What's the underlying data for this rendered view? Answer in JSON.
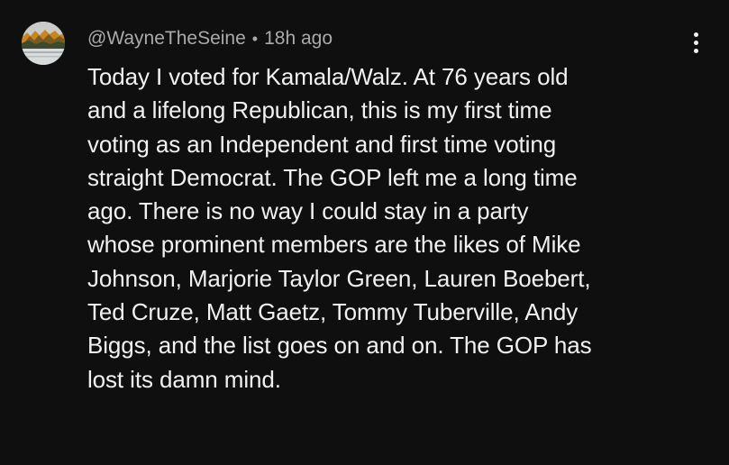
{
  "comment": {
    "author": "@WayneTheSeine",
    "separator": "•",
    "time": "18h ago",
    "text": "Today I voted for Kamala/Walz.  At 76 years old\nand a lifelong Republican, this is my first time\nvoting as an Independent and first time voting\nstraight Democrat. The GOP left me  a long time\nago. There is no way I could stay in a party\nwhose prominent members are the likes of Mike\nJohnson, Marjorie Taylor Green, Lauren Boebert,\nTed Cruze, Matt Gaetz, Tommy Tuberville, Andy\nBiggs, and the list goes on and on. The GOP has\nlost its damn mind.",
    "avatar_icon": "autumn-landscape-avatar",
    "menu_icon": "more-vertical-icon"
  },
  "colors": {
    "background": "#0f0f0f",
    "text_primary": "#f1f1f1",
    "text_secondary": "#aaaaaa"
  }
}
